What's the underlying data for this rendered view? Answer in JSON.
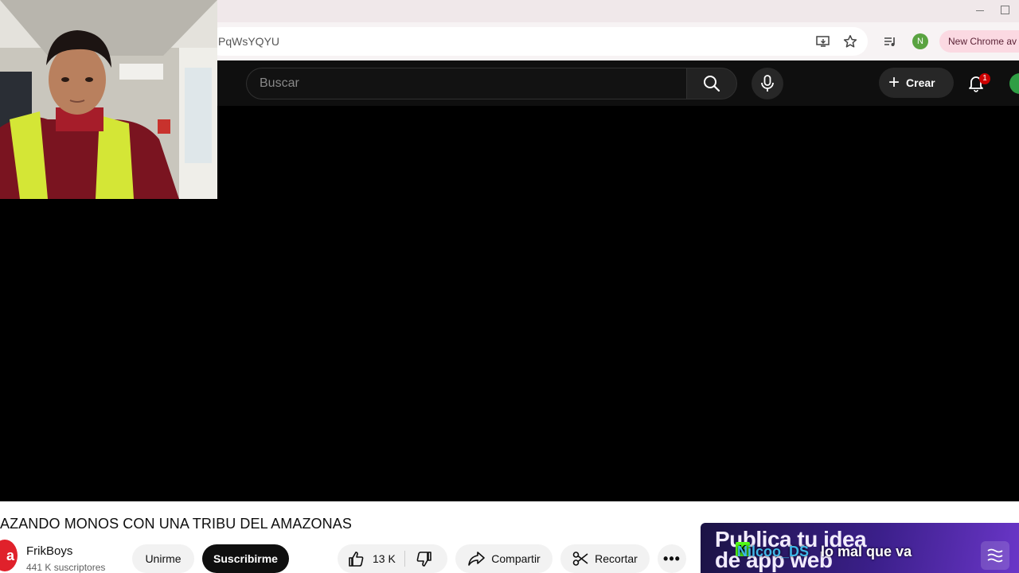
{
  "browser": {
    "url_fragment": "PqWsYQYU",
    "profile_initial": "N",
    "new_chrome_label": "New Chrome av"
  },
  "youtube_header": {
    "search_placeholder": "Buscar",
    "create_label": "Crear",
    "notification_count": "1"
  },
  "video": {
    "title": "AZANDO MONOS CON UNA TRIBU DEL AMAZONAS",
    "channel_logo_text": "a",
    "channel_name": "FrikBoys",
    "subscriber_count": "441 K suscriptores",
    "join_label": "Unirme",
    "subscribe_label": "Suscribirme",
    "like_count": "13 K",
    "share_label": "Compartir",
    "clip_label": "Recortar",
    "more_label": "•••"
  },
  "overlay": {
    "ad_text": "Publica tu idea\nde app web",
    "chat_platform_logo": "K",
    "chat_username": "Nilcoo_DS",
    "chat_message": "lo mal que va"
  },
  "colors": {
    "youtube_dark": "#0f0f0f",
    "subscribe_bg": "#0f0f0f",
    "notification_badge": "#cc0000",
    "chat_username": "#3fb6e8",
    "kick_green": "#53fc18",
    "webcam_vest": "#d4e636"
  }
}
